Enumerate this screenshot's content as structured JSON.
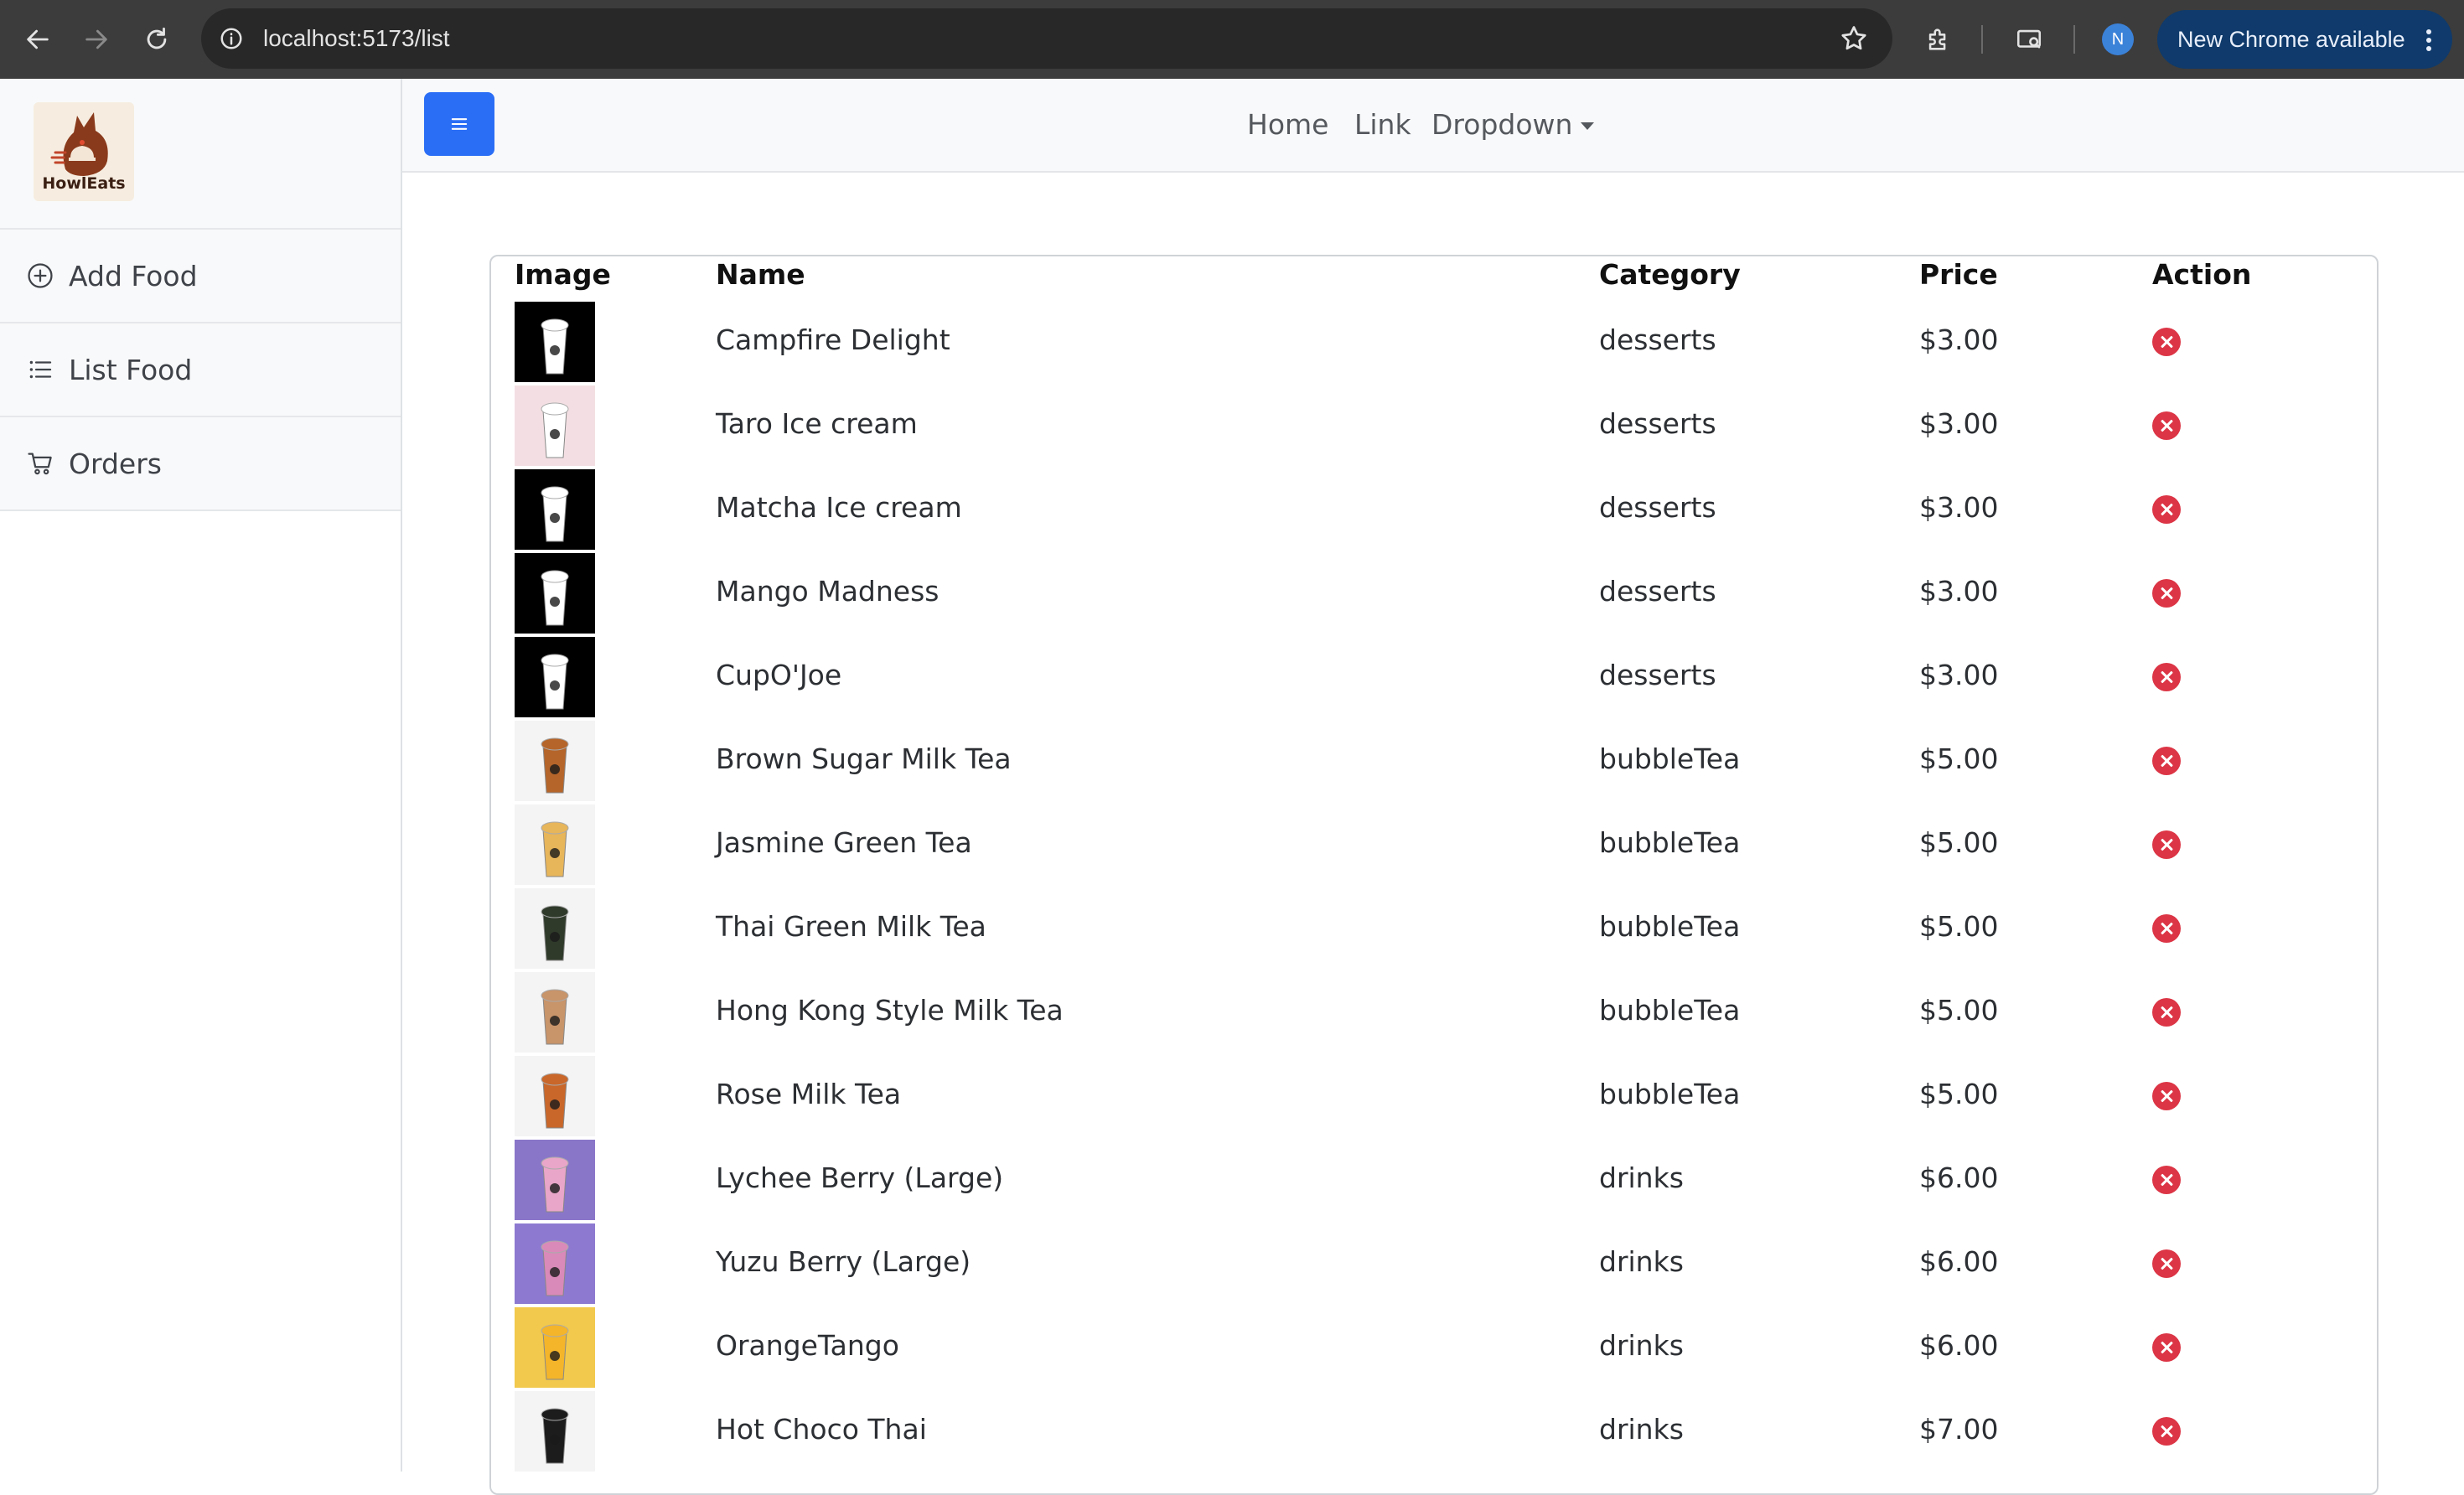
{
  "browser": {
    "url": "localhost:5173/list",
    "profile_initial": "N",
    "update_label": "New Chrome available"
  },
  "sidebar": {
    "logo_text": "HowlEats",
    "items": [
      {
        "label": "Add Food",
        "icon": "plus-circle-icon"
      },
      {
        "label": "List Food",
        "icon": "list-icon"
      },
      {
        "label": "Orders",
        "icon": "cart-icon"
      }
    ]
  },
  "topbar": {
    "links": [
      "Home",
      "Link",
      "Dropdown"
    ]
  },
  "table": {
    "headers": [
      "Image",
      "Name",
      "Category",
      "Price",
      "Action"
    ],
    "rows": [
      {
        "name": "Campfire Delight",
        "category": "desserts",
        "price": "$3.00",
        "thumb_bg": "#000000",
        "cup": "#ffffff"
      },
      {
        "name": "Taro Ice cream",
        "category": "desserts",
        "price": "$3.00",
        "thumb_bg": "#f3dfe3",
        "cup": "#ffffff"
      },
      {
        "name": "Matcha Ice cream",
        "category": "desserts",
        "price": "$3.00",
        "thumb_bg": "#000000",
        "cup": "#ffffff"
      },
      {
        "name": "Mango Madness",
        "category": "desserts",
        "price": "$3.00",
        "thumb_bg": "#000000",
        "cup": "#ffffff"
      },
      {
        "name": "CupO'Joe",
        "category": "desserts",
        "price": "$3.00",
        "thumb_bg": "#000000",
        "cup": "#ffffff"
      },
      {
        "name": "Brown Sugar Milk Tea",
        "category": "bubbleTea",
        "price": "$5.00",
        "thumb_bg": "#f4f4f4",
        "cup": "#b5652a"
      },
      {
        "name": "Jasmine Green Tea",
        "category": "bubbleTea",
        "price": "$5.00",
        "thumb_bg": "#f4f4f4",
        "cup": "#e7b55a"
      },
      {
        "name": "Thai Green Milk Tea",
        "category": "bubbleTea",
        "price": "$5.00",
        "thumb_bg": "#f4f4f4",
        "cup": "#2f3a2a"
      },
      {
        "name": "Hong Kong Style Milk Tea",
        "category": "bubbleTea",
        "price": "$5.00",
        "thumb_bg": "#f4f4f4",
        "cup": "#c8946a"
      },
      {
        "name": "Rose Milk Tea",
        "category": "bubbleTea",
        "price": "$5.00",
        "thumb_bg": "#f4f4f4",
        "cup": "#c9672a"
      },
      {
        "name": "Lychee Berry (Large)",
        "category": "drinks",
        "price": "$6.00",
        "thumb_bg": "#8a76c9",
        "cup": "#e9a6c8"
      },
      {
        "name": "Yuzu Berry (Large)",
        "category": "drinks",
        "price": "$6.00",
        "thumb_bg": "#8d7ad0",
        "cup": "#d98ab8"
      },
      {
        "name": "OrangeTango",
        "category": "drinks",
        "price": "$6.00",
        "thumb_bg": "#f2c94c",
        "cup": "#f4b52a"
      },
      {
        "name": "Hot Choco Thai",
        "category": "drinks",
        "price": "$7.00",
        "thumb_bg": "#f4f4f4",
        "cup": "#1c1c1c"
      }
    ]
  },
  "colors": {
    "accent": "#2b6ef6",
    "delete": "#dc3545"
  }
}
